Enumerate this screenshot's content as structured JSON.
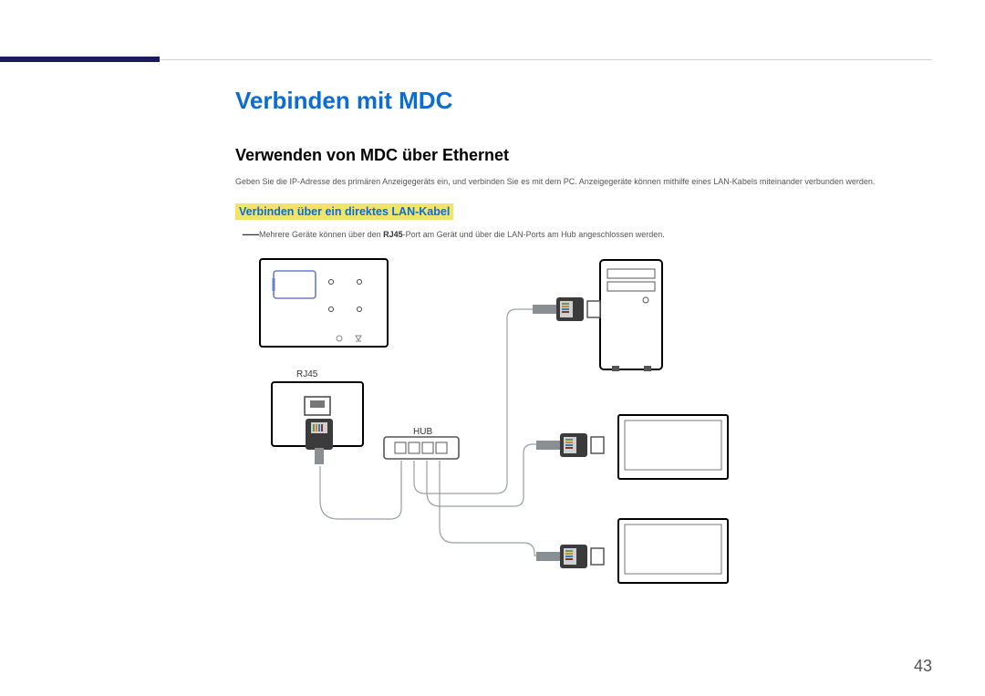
{
  "page": {
    "number": "43"
  },
  "heading": {
    "main": "Verbinden mit MDC",
    "sub": "Verwenden von MDC über Ethernet",
    "highlighted": "Verbinden über ein direktes LAN-Kabel"
  },
  "paragraphs": {
    "intro": "Geben Sie die IP-Adresse des primären Anzeigegeräts ein, und verbinden Sie es mit dem PC. Anzeigegeräte können mithilfe eines LAN-Kabels miteinander verbunden werden."
  },
  "note": {
    "pre": "Mehrere Geräte können über den ",
    "bold": "RJ45",
    "post": "-Port am Gerät und über die LAN-Ports am Hub angeschlossen werden."
  },
  "diagram": {
    "labels": {
      "rj45": "RJ45",
      "hub": "HUB"
    }
  }
}
